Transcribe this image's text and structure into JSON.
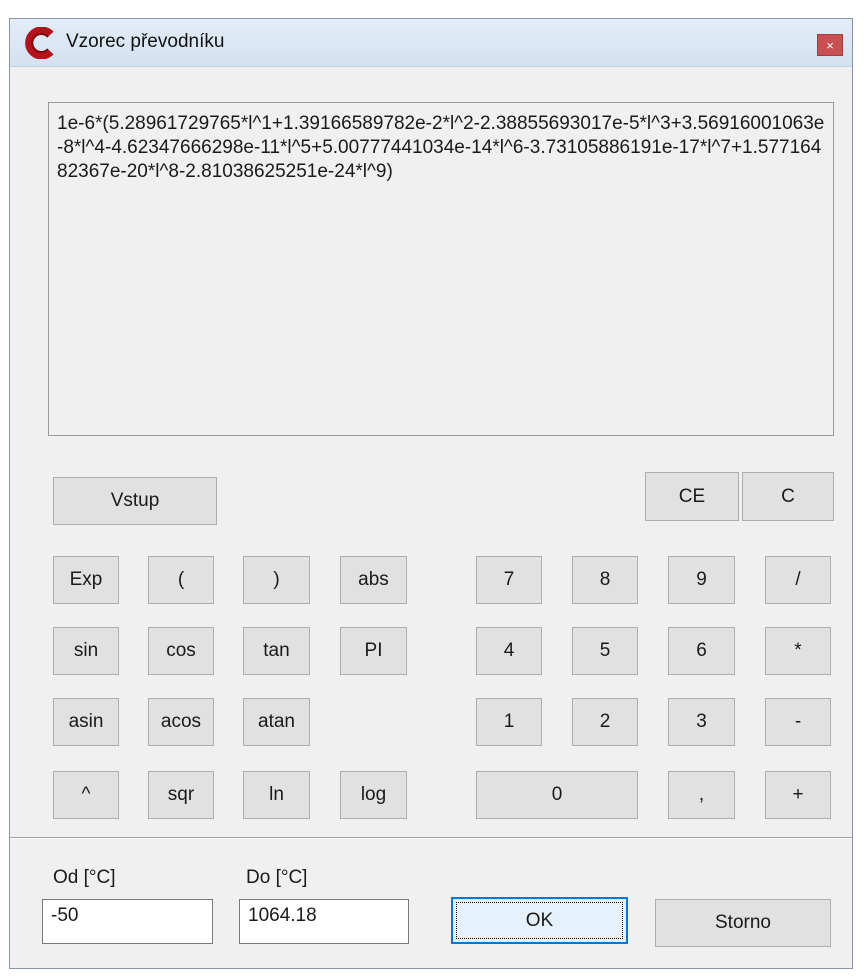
{
  "window": {
    "title": "Vzorec převodníku",
    "close_label": "×"
  },
  "formula": {
    "text": "1e-6*(5.28961729765*l^1+1.39166589782e-2*l^2-2.38855693017e-5*l^3+3.56916001063e-8*l^4-4.62347666298e-11*l^5+5.00777441034e-14*l^6-3.73105886191e-17*l^7+1.57716482367e-20*l^8-2.81038625251e-24*l^9)"
  },
  "buttons": {
    "vstup": "Vstup",
    "ce": "CE",
    "c": "C",
    "exp": "Exp",
    "lparen": "(",
    "rparen": ")",
    "abs": "abs",
    "sin": "sin",
    "cos": "cos",
    "tan": "tan",
    "pi": "PI",
    "asin": "asin",
    "acos": "acos",
    "atan": "atan",
    "pow": "^",
    "sqr": "sqr",
    "ln": "ln",
    "log": "log",
    "d7": "7",
    "d8": "8",
    "d9": "9",
    "div": "/",
    "d4": "4",
    "d5": "5",
    "d6": "6",
    "mul": "*",
    "d1": "1",
    "d2": "2",
    "d3": "3",
    "sub": "-",
    "d0": "0",
    "comma": ",",
    "add": "+"
  },
  "range": {
    "from_label": "Od [°C]",
    "from_value": "-50",
    "to_label": "Do [°C]",
    "to_value": "1064.18"
  },
  "actions": {
    "ok": "OK",
    "cancel": "Storno"
  },
  "colors": {
    "logo": "#b5121b",
    "close": "#c75050",
    "focus": "#0078d7"
  }
}
